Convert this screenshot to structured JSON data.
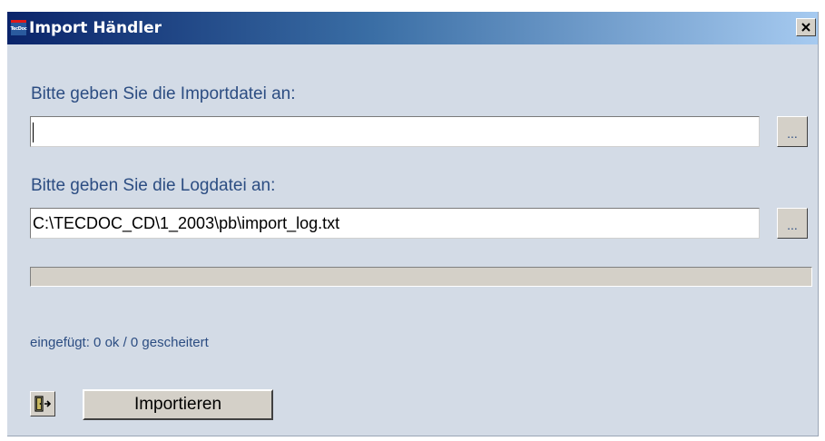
{
  "window": {
    "title": "Import Händler",
    "logo_text": "TecDoc"
  },
  "import_file": {
    "label": "Bitte geben Sie die Importdatei an:",
    "value": "",
    "browse_label": "..."
  },
  "log_file": {
    "label": "Bitte geben Sie die Logdatei an:",
    "value": "C:\\TECDOC_CD\\1_2003\\pb\\import_log.txt",
    "browse_label": "..."
  },
  "progress": {
    "fraction": 0
  },
  "status": {
    "text": "eingefügt:  0 ok / 0 gescheitert"
  },
  "actions": {
    "exit_icon": "exit-door-icon",
    "import_label": "Importieren"
  },
  "colors": {
    "title_start": "#0a246a",
    "title_end": "#a6caf0",
    "window_bg": "#d3dbe6",
    "label_text": "#2c4d82"
  }
}
